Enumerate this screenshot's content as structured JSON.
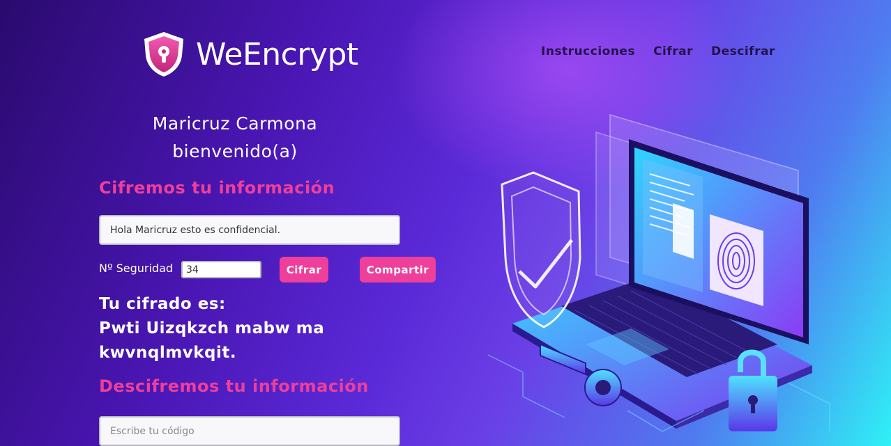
{
  "brand": {
    "name": "WeEncrypt"
  },
  "nav": {
    "items": [
      "Instrucciones",
      "Cifrar",
      "Descifrar"
    ]
  },
  "welcome": {
    "name": "Maricruz Carmona",
    "greeting": "bienvenido(a)"
  },
  "encrypt": {
    "title": "Cifremos tu información",
    "message_value": "Hola Maricruz esto es confidencial.",
    "security_label": "Nº Seguridad",
    "security_value": "34",
    "cipher_button": "Cifrar",
    "share_button": "Compartir",
    "result_label": "Tu cifrado es:",
    "result_value": "Pwti Uizqkzch mabw ma kwvnqlmvkqit."
  },
  "decrypt": {
    "title": "Descifremos tu información",
    "code_placeholder": "Escribe tu código"
  },
  "colors": {
    "accent": "#ee3f9a",
    "nav_text": "#22124a"
  }
}
